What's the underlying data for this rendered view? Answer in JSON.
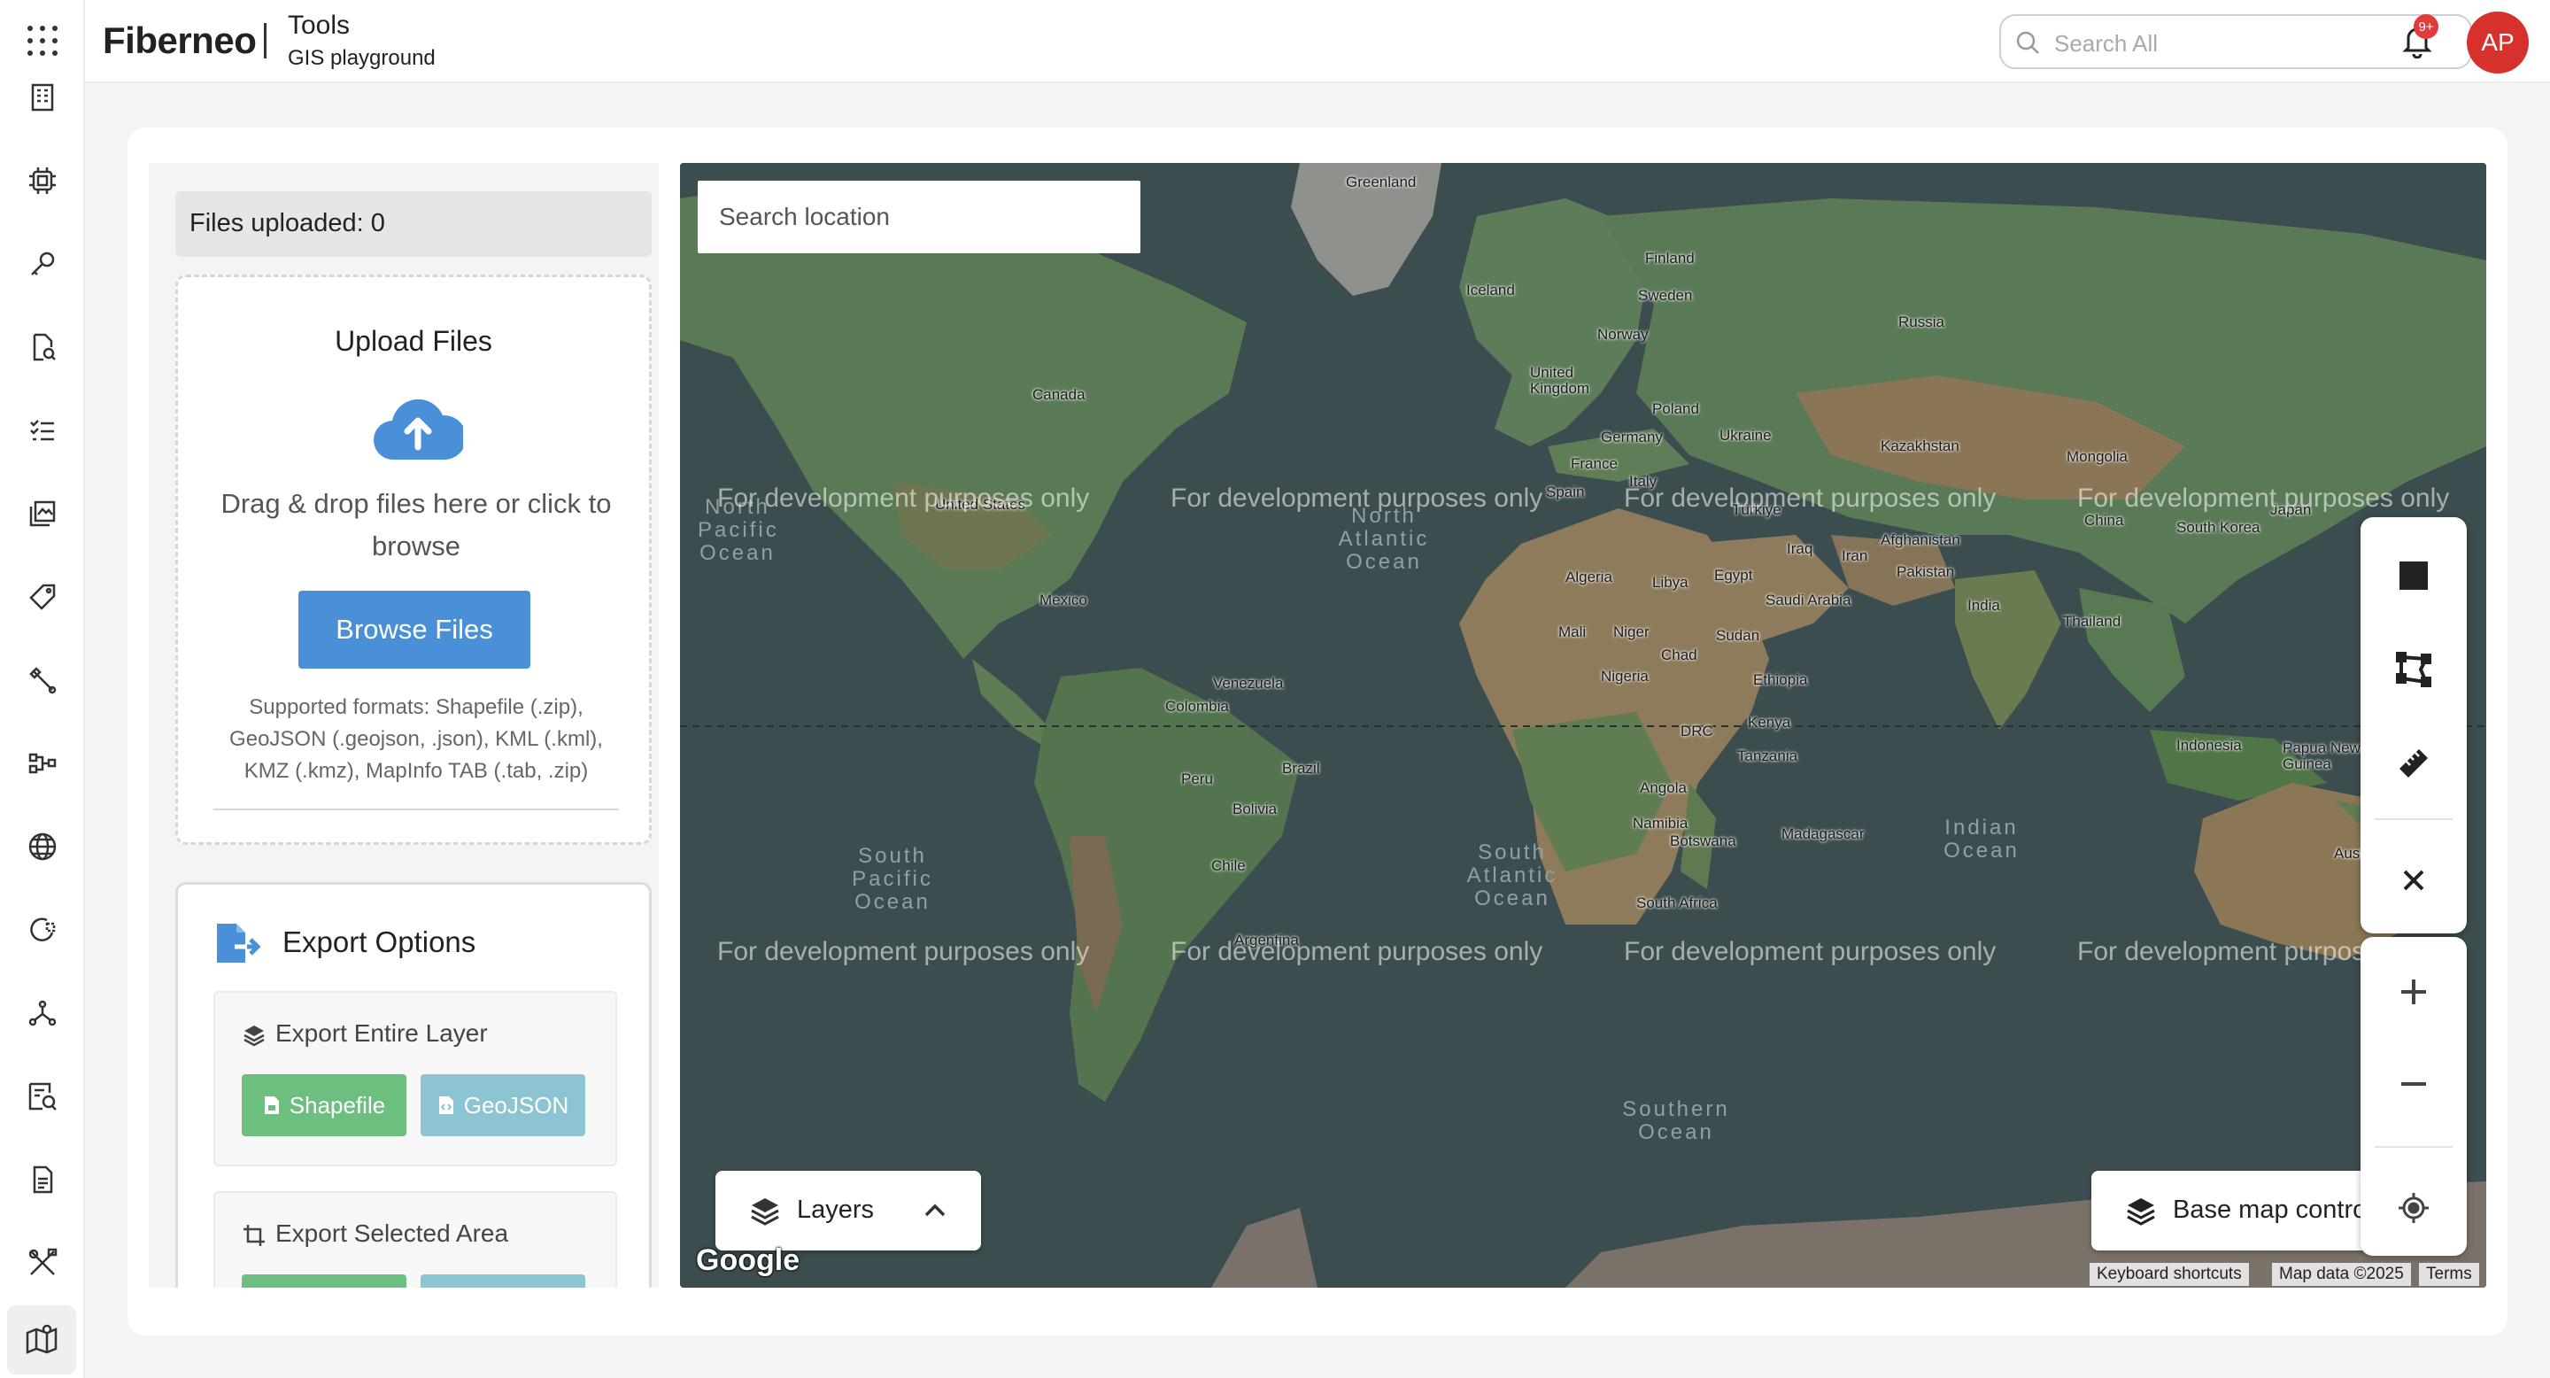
{
  "header": {
    "brand": "Fiberneo",
    "title": "Tools",
    "subtitle": "GIS playground",
    "search_placeholder": "Search All",
    "notification_badge": "9+",
    "avatar_initials": "AP"
  },
  "sidebar": {
    "icons": [
      "apps-grid-icon",
      "building-icon",
      "chip-icon",
      "wrench-key-icon",
      "document-search-icon",
      "checklist-icon",
      "map-stack-icon",
      "tag-icon",
      "tools-icon",
      "hierarchy-icon",
      "globe-icon",
      "capture-icon",
      "network-icon",
      "report-search-icon",
      "file-report-icon",
      "tools-cross-icon",
      "gis-map-icon"
    ],
    "active": "gis-map-icon"
  },
  "left_panel": {
    "files_uploaded": "Files uploaded: 0",
    "upload_title": "Upload Files",
    "drag_text": "Drag & drop files here or click to browse",
    "browse_button": "Browse Files",
    "supported_formats": "Supported formats: Shapefile (.zip), GeoJSON (.geojson, .json), KML (.kml), KMZ (.kmz), MapInfo TAB (.tab, .zip)",
    "export_title": "Export Options",
    "export_entire_layer": "Export Entire Layer",
    "export_selected_area": "Export Selected Area",
    "shapefile_button": "Shapefile",
    "geojson_button": "GeoJSON",
    "colors": {
      "shapefile": "#6dbf80",
      "geojson": "#8cc5d1",
      "accent": "#4a90d9"
    }
  },
  "map": {
    "search_placeholder": "Search location",
    "watermark": "For development purposes only",
    "labels": {
      "greenland": "Greenland",
      "finland": "Finland",
      "sweden": "Sweden",
      "norway": "Norway",
      "iceland": "Iceland",
      "russia": "Russia",
      "canada": "Canada",
      "united_kingdom": "United Kingdom",
      "poland": "Poland",
      "germany": "Germany",
      "ukraine": "Ukraine",
      "kazakhstan": "Kazakhstan",
      "mongolia": "Mongolia",
      "france": "France",
      "italy": "Italy",
      "spain": "Spain",
      "turkiye": "Türkiye",
      "china": "China",
      "south_korea": "South Korea",
      "japan": "Japan",
      "united_states": "United States",
      "afghanistan": "Afghanistan",
      "iraq": "Iraq",
      "iran": "Iran",
      "pakistan": "Pakistan",
      "algeria": "Algeria",
      "libya": "Libya",
      "egypt": "Egypt",
      "saudi_arabia": "Saudi Arabia",
      "india": "India",
      "thailand": "Thailand",
      "mexico": "Mexico",
      "mali": "Mali",
      "niger": "Niger",
      "sudan": "Sudan",
      "chad": "Chad",
      "nigeria": "Nigeria",
      "ethiopia": "Ethiopia",
      "venezuela": "Venezuela",
      "colombia": "Colombia",
      "drc": "DRC",
      "kenya": "Kenya",
      "tanzania": "Tanzania",
      "indonesia": "Indonesia",
      "papua_new_guinea": "Papua New Guinea",
      "brazil": "Brazil",
      "peru": "Peru",
      "bolivia": "Bolivia",
      "angola": "Angola",
      "namibia": "Namibia",
      "botswana": "Botswana",
      "madagascar": "Madagascar",
      "australia": "Australia",
      "chile": "Chile",
      "south_africa": "South Africa",
      "argentina": "Argentina"
    },
    "oceans": {
      "north_pacific": "North Pacific Ocean",
      "north_atlantic": "North Atlantic Ocean",
      "south_pacific": "South Pacific Ocean",
      "south_atlantic": "South Atlantic Ocean",
      "indian": "Indian Ocean",
      "southern": "Southern Ocean"
    },
    "layers_label": "Layers",
    "basemap_label": "Base map controls",
    "google_logo": "Google",
    "attribution": [
      "Keyboard shortcuts",
      "Map data ©2025",
      "Terms"
    ]
  }
}
